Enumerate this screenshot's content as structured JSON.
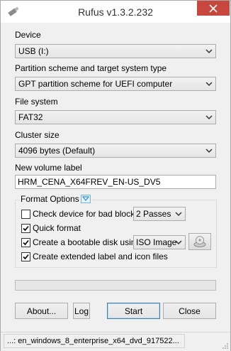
{
  "window": {
    "title": "Rufus v1.3.2.232"
  },
  "device": {
    "label": "Device",
    "value": "USB (I:)"
  },
  "partition": {
    "label": "Partition scheme and target system type",
    "value": "GPT partition scheme for UEFI computer"
  },
  "filesystem": {
    "label": "File system",
    "value": "FAT32"
  },
  "cluster": {
    "label": "Cluster size",
    "value": "4096 bytes (Default)"
  },
  "volume": {
    "label": "New volume label",
    "value": "HRM_CENA_X64FREV_EN-US_DV5"
  },
  "format_options": {
    "title": "Format Options",
    "bad_blocks": {
      "label": "Check device for bad blocks:",
      "checked": false,
      "passes": "2 Passes"
    },
    "quick_format": {
      "label": "Quick format",
      "checked": true
    },
    "bootable": {
      "label": "Create a bootable disk using:",
      "checked": true,
      "type": "ISO Image"
    },
    "extended_label": {
      "label": "Create extended label and icon files",
      "checked": true
    }
  },
  "progress": {
    "value": 0
  },
  "buttons": {
    "about": "About...",
    "log": "Log",
    "start": "Start",
    "close": "Close"
  },
  "status": {
    "text": "...: en_windows_8_enterprise_x64_dvd_917522..."
  },
  "colors": {
    "close_button": "#c7463d",
    "default_button_border": "#3c7fb1",
    "legend_toggle": "#6fb6e8"
  }
}
